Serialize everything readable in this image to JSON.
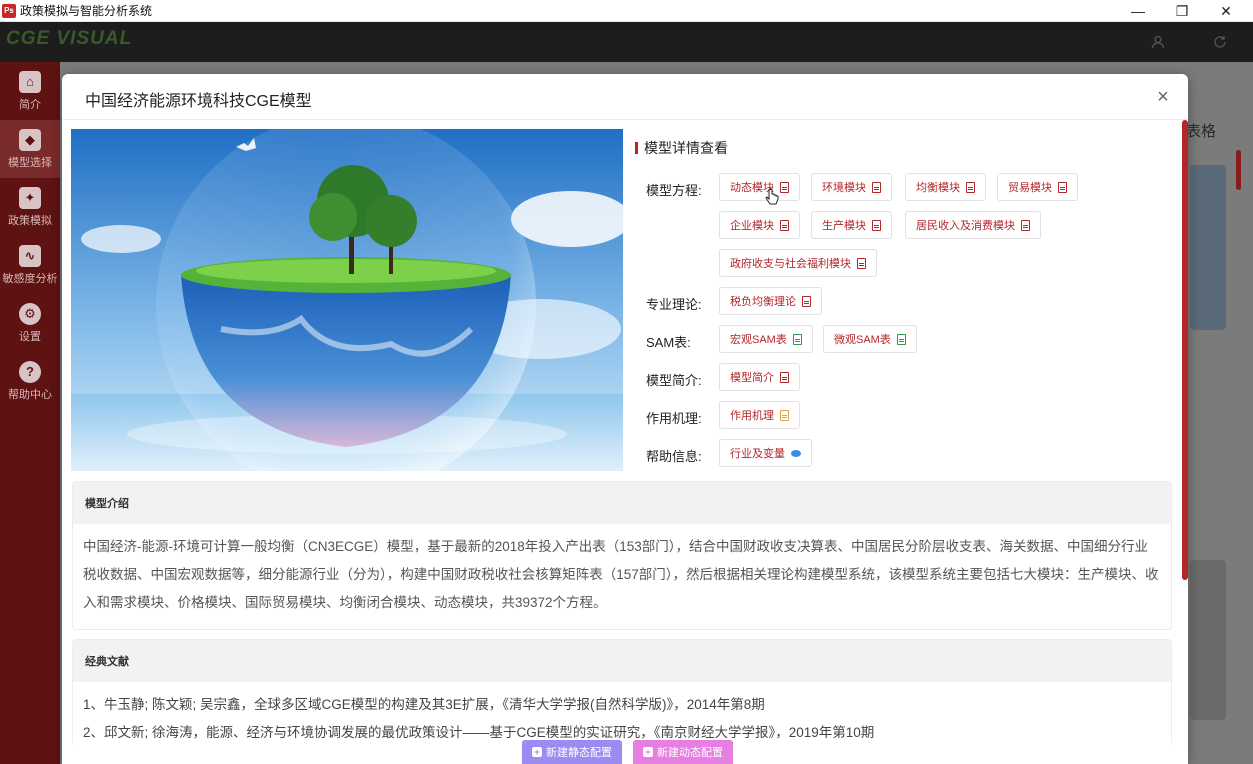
{
  "window": {
    "icon_text": "Ps",
    "title": "政策模拟与智能分析系统",
    "minimize": "—",
    "restore": "❐",
    "close": "✕"
  },
  "header": {
    "logo": "CGE VISUAL",
    "user_icon": "user-icon",
    "refresh_icon": "refresh-icon"
  },
  "sidebar": {
    "items": [
      {
        "label": "简介",
        "icon": "home-icon",
        "glyph": "⌂"
      },
      {
        "label": "模型选择",
        "icon": "cube-icon",
        "glyph": "◆"
      },
      {
        "label": "政策模拟",
        "icon": "policy-icon",
        "glyph": "✦"
      },
      {
        "label": "敏感度分析",
        "icon": "chart-icon",
        "glyph": "∿"
      },
      {
        "label": "设置",
        "icon": "gear-icon",
        "glyph": "⚙"
      },
      {
        "label": "帮助中心",
        "icon": "help-icon",
        "glyph": "?"
      }
    ],
    "active_index": 1
  },
  "background": {
    "tab_text": "表格"
  },
  "modal": {
    "title": "中国经济能源环境科技CGE模型",
    "close": "×",
    "details_title": "模型详情查看",
    "rows": {
      "equations_label": "模型方程:",
      "theory_label": "专业理论:",
      "sam_label": "SAM表:",
      "intro_label": "模型简介:",
      "mechanism_label": "作用机理:",
      "help_label": "帮助信息:"
    },
    "equation_tags": [
      "动态模块",
      "环境模块",
      "均衡模块",
      "贸易模块",
      "企业模块",
      "生产模块",
      "居民收入及消费模块",
      "政府收支与社会福利模块"
    ],
    "theory_tags": [
      "税负均衡理论"
    ],
    "sam_tags": [
      "宏观SAM表",
      "微观SAM表"
    ],
    "intro_tags": [
      "模型简介"
    ],
    "mechanism_tags": [
      "作用机理"
    ],
    "help_tags": [
      "行业及变量"
    ],
    "intro_card": {
      "title": "模型介绍",
      "text": "中国经济-能源-环境可计算一般均衡（CN3ECGE）模型，基于最新的2018年投入产出表（153部门），结合中国财政收支决算表、中国居民分阶层收支表、海关数据、中国细分行业税收数据、中国宏观数据等，细分能源行业（分为），构建中国财政税收社会核算矩阵表（157部门），然后根据相关理论构建模型系统，该模型系统主要包括七大模块：生产模块、收入和需求模块、价格模块、国际贸易模块、均衡闭合模块、动态模块，共39372个方程。"
    },
    "refs_card": {
      "title": "经典文献",
      "items": [
        "1、牛玉静; 陈文颖; 吴宗鑫，全球多区域CGE模型的构建及其3E扩展，《清华大学学报(自然科学版)》，2014年第8期",
        "2、邱文新; 徐海涛，能源、经济与环境协调发展的最优政策设计——基于CGE模型的实证研究，《南京财经大学学报》，2019年第10期"
      ]
    },
    "buttons": {
      "new_static": "新建静态配置",
      "new_dynamic": "新建动态配置"
    }
  },
  "colors": {
    "accent": "#b3262a",
    "sidebar": "#5e1212",
    "static_button": "#9a8cf2",
    "dynamic_button": "#e77fe2"
  }
}
